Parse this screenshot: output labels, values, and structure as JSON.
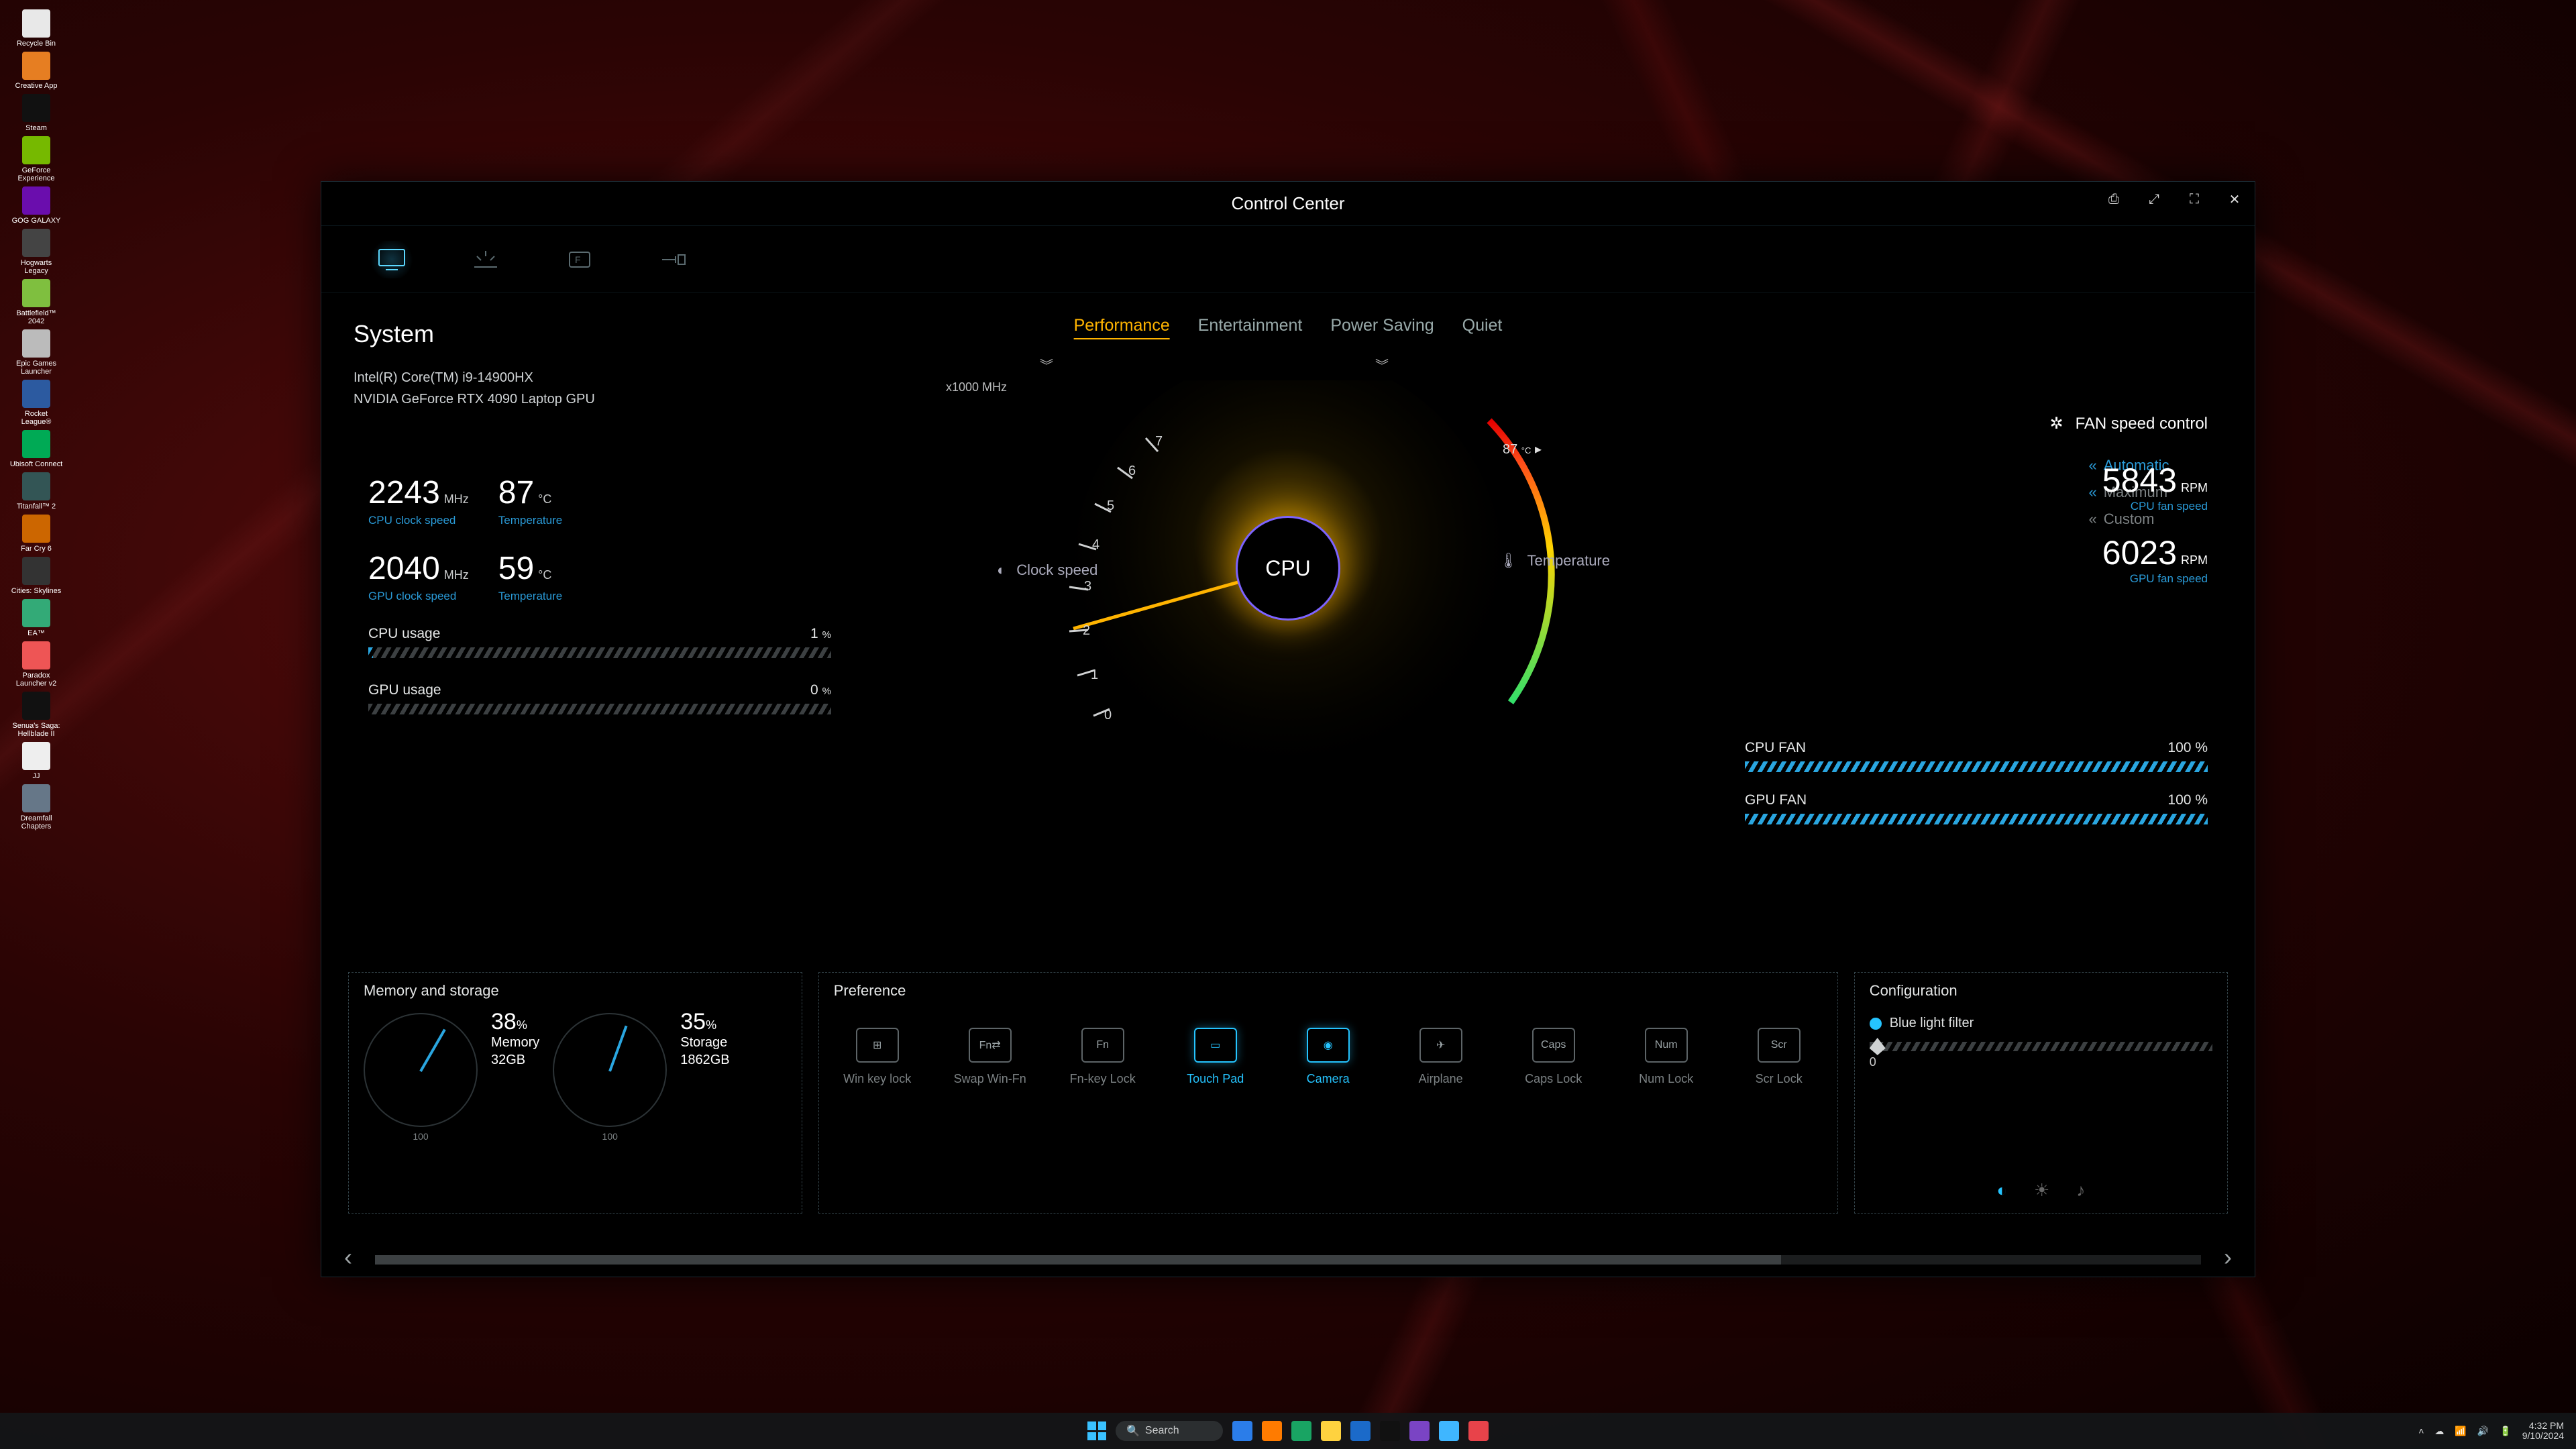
{
  "desktop": {
    "icons": [
      "Recycle Bin",
      "Creative App",
      "Steam",
      "GeForce Experience",
      "GOG GALAXY",
      "Hogwarts Legacy",
      "Battlefield™ 2042",
      "Epic Games Launcher",
      "Rocket League®",
      "Ubisoft Connect",
      "Titanfall™ 2",
      "Far Cry 6",
      "Cities: Skylines",
      "EA™",
      "Paradox Launcher v2",
      "Senua's Saga: Hellblade II",
      "JJ",
      "Dreamfall Chapters"
    ]
  },
  "window": {
    "title": "Control Center",
    "nav": [
      "system",
      "lighting",
      "keyboard",
      "peripherals"
    ],
    "activeNav": 0
  },
  "system": {
    "heading": "System",
    "cpuName": "Intel(R) Core(TM) i9-14900HX",
    "gpuName": "NVIDIA GeForce RTX 4090 Laptop GPU"
  },
  "modes": {
    "items": [
      "Performance",
      "Entertainment",
      "Power Saving",
      "Quiet"
    ],
    "active": 0
  },
  "gauge": {
    "centerLabel": "CPU",
    "leftLabel": "Clock speed",
    "rightLabel": "Temperature",
    "xAxis": "x1000 MHz",
    "tempMarker": "87",
    "tempMarkerUnit": "°C",
    "ticks": [
      "0",
      "1",
      "2",
      "3",
      "4",
      "5",
      "6",
      "7"
    ]
  },
  "stats": {
    "cpuClock": {
      "value": "2243",
      "unit": "MHz",
      "label": "CPU clock speed"
    },
    "cpuTemp": {
      "value": "87",
      "unit": "°C",
      "label": "Temperature"
    },
    "gpuClock": {
      "value": "2040",
      "unit": "MHz",
      "label": "GPU clock speed"
    },
    "gpuTemp": {
      "value": "59",
      "unit": "°C",
      "label": "Temperature"
    },
    "cpuUsage": {
      "label": "CPU usage",
      "value": "1",
      "unit": "%"
    },
    "gpuUsage": {
      "label": "GPU usage",
      "value": "0",
      "unit": "%"
    }
  },
  "fan": {
    "title": "FAN speed control",
    "modes": [
      "Automatic",
      "Maximum",
      "Custom"
    ],
    "activeMode": 0,
    "cpu": {
      "value": "5843",
      "unit": "RPM",
      "label": "CPU fan speed"
    },
    "gpu": {
      "value": "6023",
      "unit": "RPM",
      "label": "GPU fan speed"
    },
    "cpuFan": {
      "label": "CPU FAN",
      "value": "100",
      "unit": "%"
    },
    "gpuFan": {
      "label": "GPU FAN",
      "value": "100",
      "unit": "%"
    }
  },
  "memory": {
    "title": "Memory and storage",
    "mem": {
      "pct": "38",
      "unit": "%",
      "label": "Memory",
      "total": "32GB",
      "scale": "100"
    },
    "sto": {
      "pct": "35",
      "unit": "%",
      "label": "Storage",
      "total": "1862GB",
      "scale": "100"
    }
  },
  "pref": {
    "title": "Preference",
    "items": [
      {
        "label": "Win key lock",
        "short": "⊞",
        "on": false
      },
      {
        "label": "Swap Win-Fn",
        "short": "Fn⇄",
        "on": false
      },
      {
        "label": "Fn-key Lock",
        "short": "Fn",
        "on": false
      },
      {
        "label": "Touch Pad",
        "short": "▭",
        "on": true
      },
      {
        "label": "Camera",
        "short": "◉",
        "on": true
      },
      {
        "label": "Airplane",
        "short": "✈",
        "on": false
      },
      {
        "label": "Caps Lock",
        "short": "Caps",
        "on": false
      },
      {
        "label": "Num Lock",
        "short": "Num",
        "on": false
      },
      {
        "label": "Scr Lock",
        "short": "Scr",
        "on": false
      }
    ]
  },
  "config": {
    "title": "Configuration",
    "blueLight": {
      "label": "Blue light filter",
      "value": "0"
    }
  },
  "taskbar": {
    "search": "Search",
    "time": "4:32 PM",
    "date": "9/10/2024"
  }
}
